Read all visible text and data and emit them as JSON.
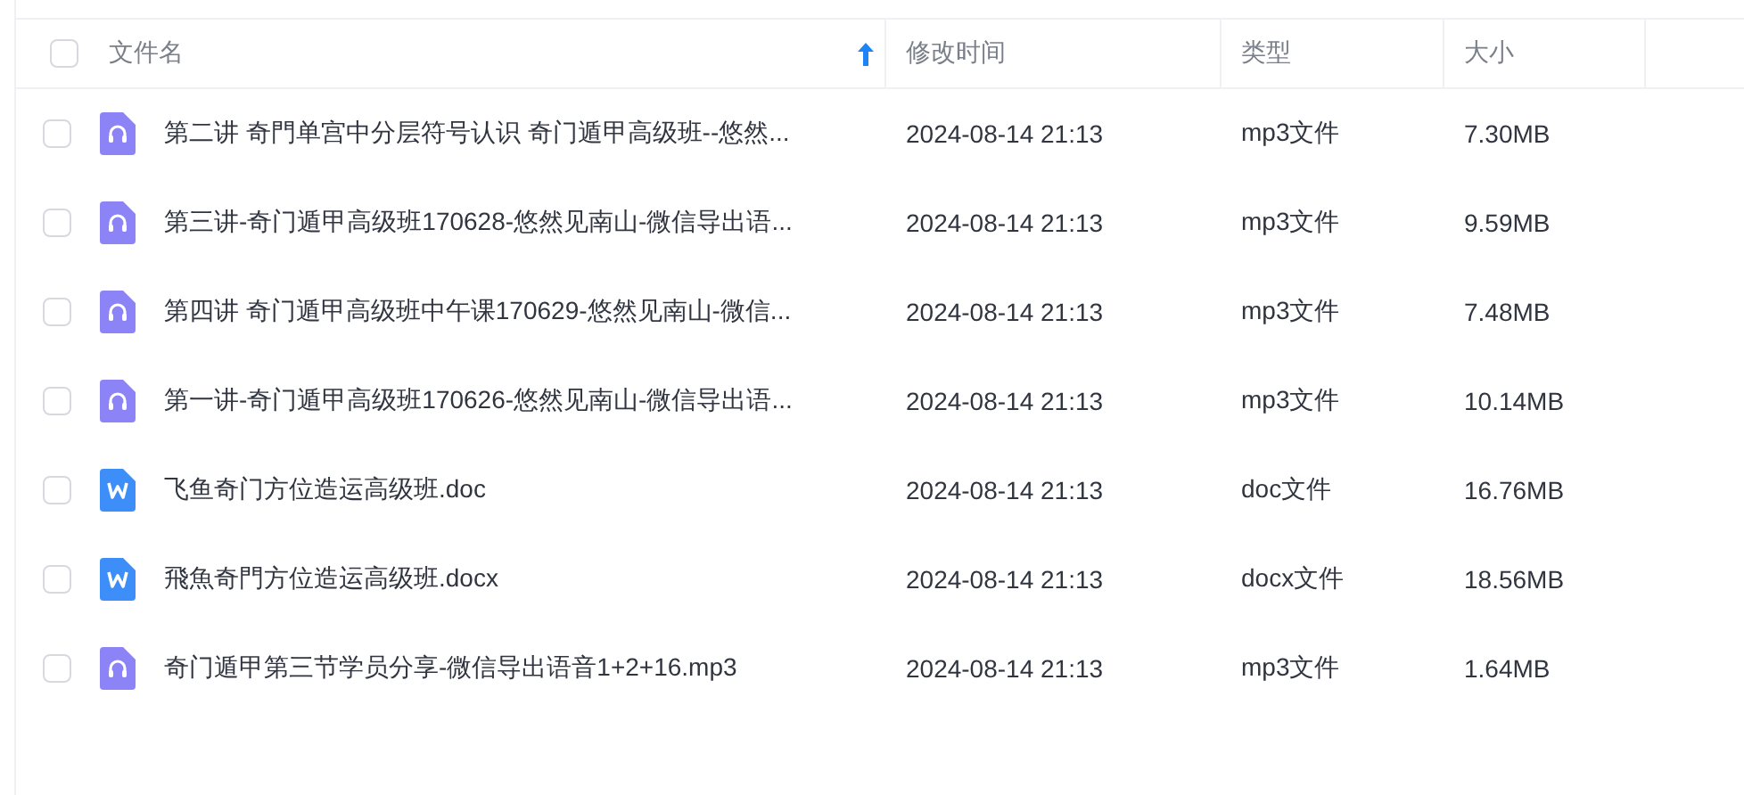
{
  "table": {
    "select_all": {
      "checked": false
    },
    "columns": [
      {
        "label": "文件名",
        "sorted": true,
        "ascending": true
      },
      {
        "label": "修改时间",
        "sorted": false
      },
      {
        "label": "类型",
        "sorted": false
      },
      {
        "label": "大小",
        "sorted": false
      }
    ],
    "rows": [
      {
        "checked": false,
        "kind": "audio",
        "name": "第二讲 奇門单宫中分层符号认识 奇门遁甲高级班--悠然...",
        "modified": "2024-08-14 21:13",
        "type": "mp3文件",
        "size": "7.30MB"
      },
      {
        "checked": false,
        "kind": "audio",
        "name": "第三讲-奇门遁甲高级班170628-悠然见南山-微信导出语...",
        "modified": "2024-08-14 21:13",
        "type": "mp3文件",
        "size": "9.59MB"
      },
      {
        "checked": false,
        "kind": "audio",
        "name": "第四讲 奇门遁甲高级班中午课170629-悠然见南山-微信...",
        "modified": "2024-08-14 21:13",
        "type": "mp3文件",
        "size": "7.48MB"
      },
      {
        "checked": false,
        "kind": "audio",
        "name": "第一讲-奇门遁甲高级班170626-悠然见南山-微信导出语...",
        "modified": "2024-08-14 21:13",
        "type": "mp3文件",
        "size": "10.14MB"
      },
      {
        "checked": false,
        "kind": "word",
        "name": "飞鱼奇门方位造运高级班.doc",
        "modified": "2024-08-14 21:13",
        "type": "doc文件",
        "size": "16.76MB"
      },
      {
        "checked": false,
        "kind": "word",
        "name": "飛魚奇門方位造运高级班.docx",
        "modified": "2024-08-14 21:13",
        "type": "docx文件",
        "size": "18.56MB"
      },
      {
        "checked": false,
        "kind": "audio",
        "name": "奇门遁甲第三节学员分享-微信导出语音1+2+16.mp3",
        "modified": "2024-08-14 21:13",
        "type": "mp3文件",
        "size": "1.64MB"
      }
    ]
  }
}
